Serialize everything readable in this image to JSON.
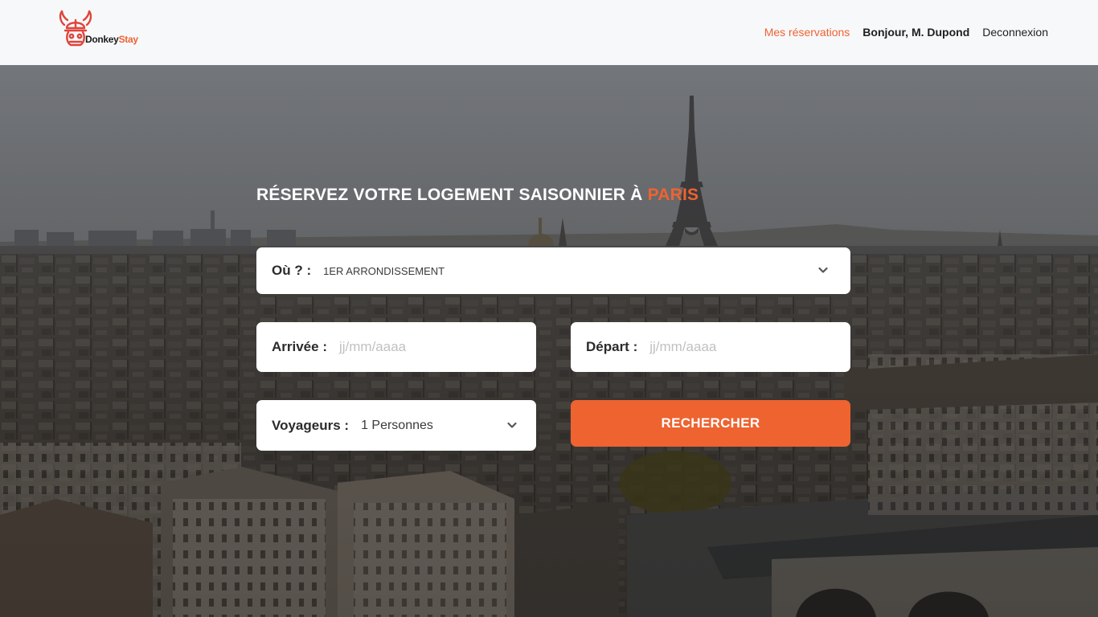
{
  "brand": {
    "name_part1": "Donkey",
    "name_part2": "Stay",
    "logo_icon": "viking-donkey-logo-icon",
    "accent_color": "#ee6330"
  },
  "nav": {
    "reservations": "Mes réservations",
    "greeting": "Bonjour, M. Dupond",
    "logout": "Deconnexion"
  },
  "hero": {
    "headline_prefix": "RÉSERVEZ VOTRE LOGEMENT SAISONNIER À",
    "headline_city": "PARIS",
    "background_image": "paris-skyline-with-eiffel-tower"
  },
  "search": {
    "location": {
      "label": "Où ? :",
      "value": "1ER ARRONDISSEMENT",
      "icon": "chevron-down-icon"
    },
    "arrival": {
      "label": "Arrivée :",
      "placeholder": "jj/mm/aaaa"
    },
    "departure": {
      "label": "Départ :",
      "placeholder": "jj/mm/aaaa"
    },
    "travelers": {
      "label": "Voyageurs :",
      "value": "1 Personnes",
      "icon": "chevron-down-icon"
    },
    "submit_label": "RECHERCHER"
  }
}
